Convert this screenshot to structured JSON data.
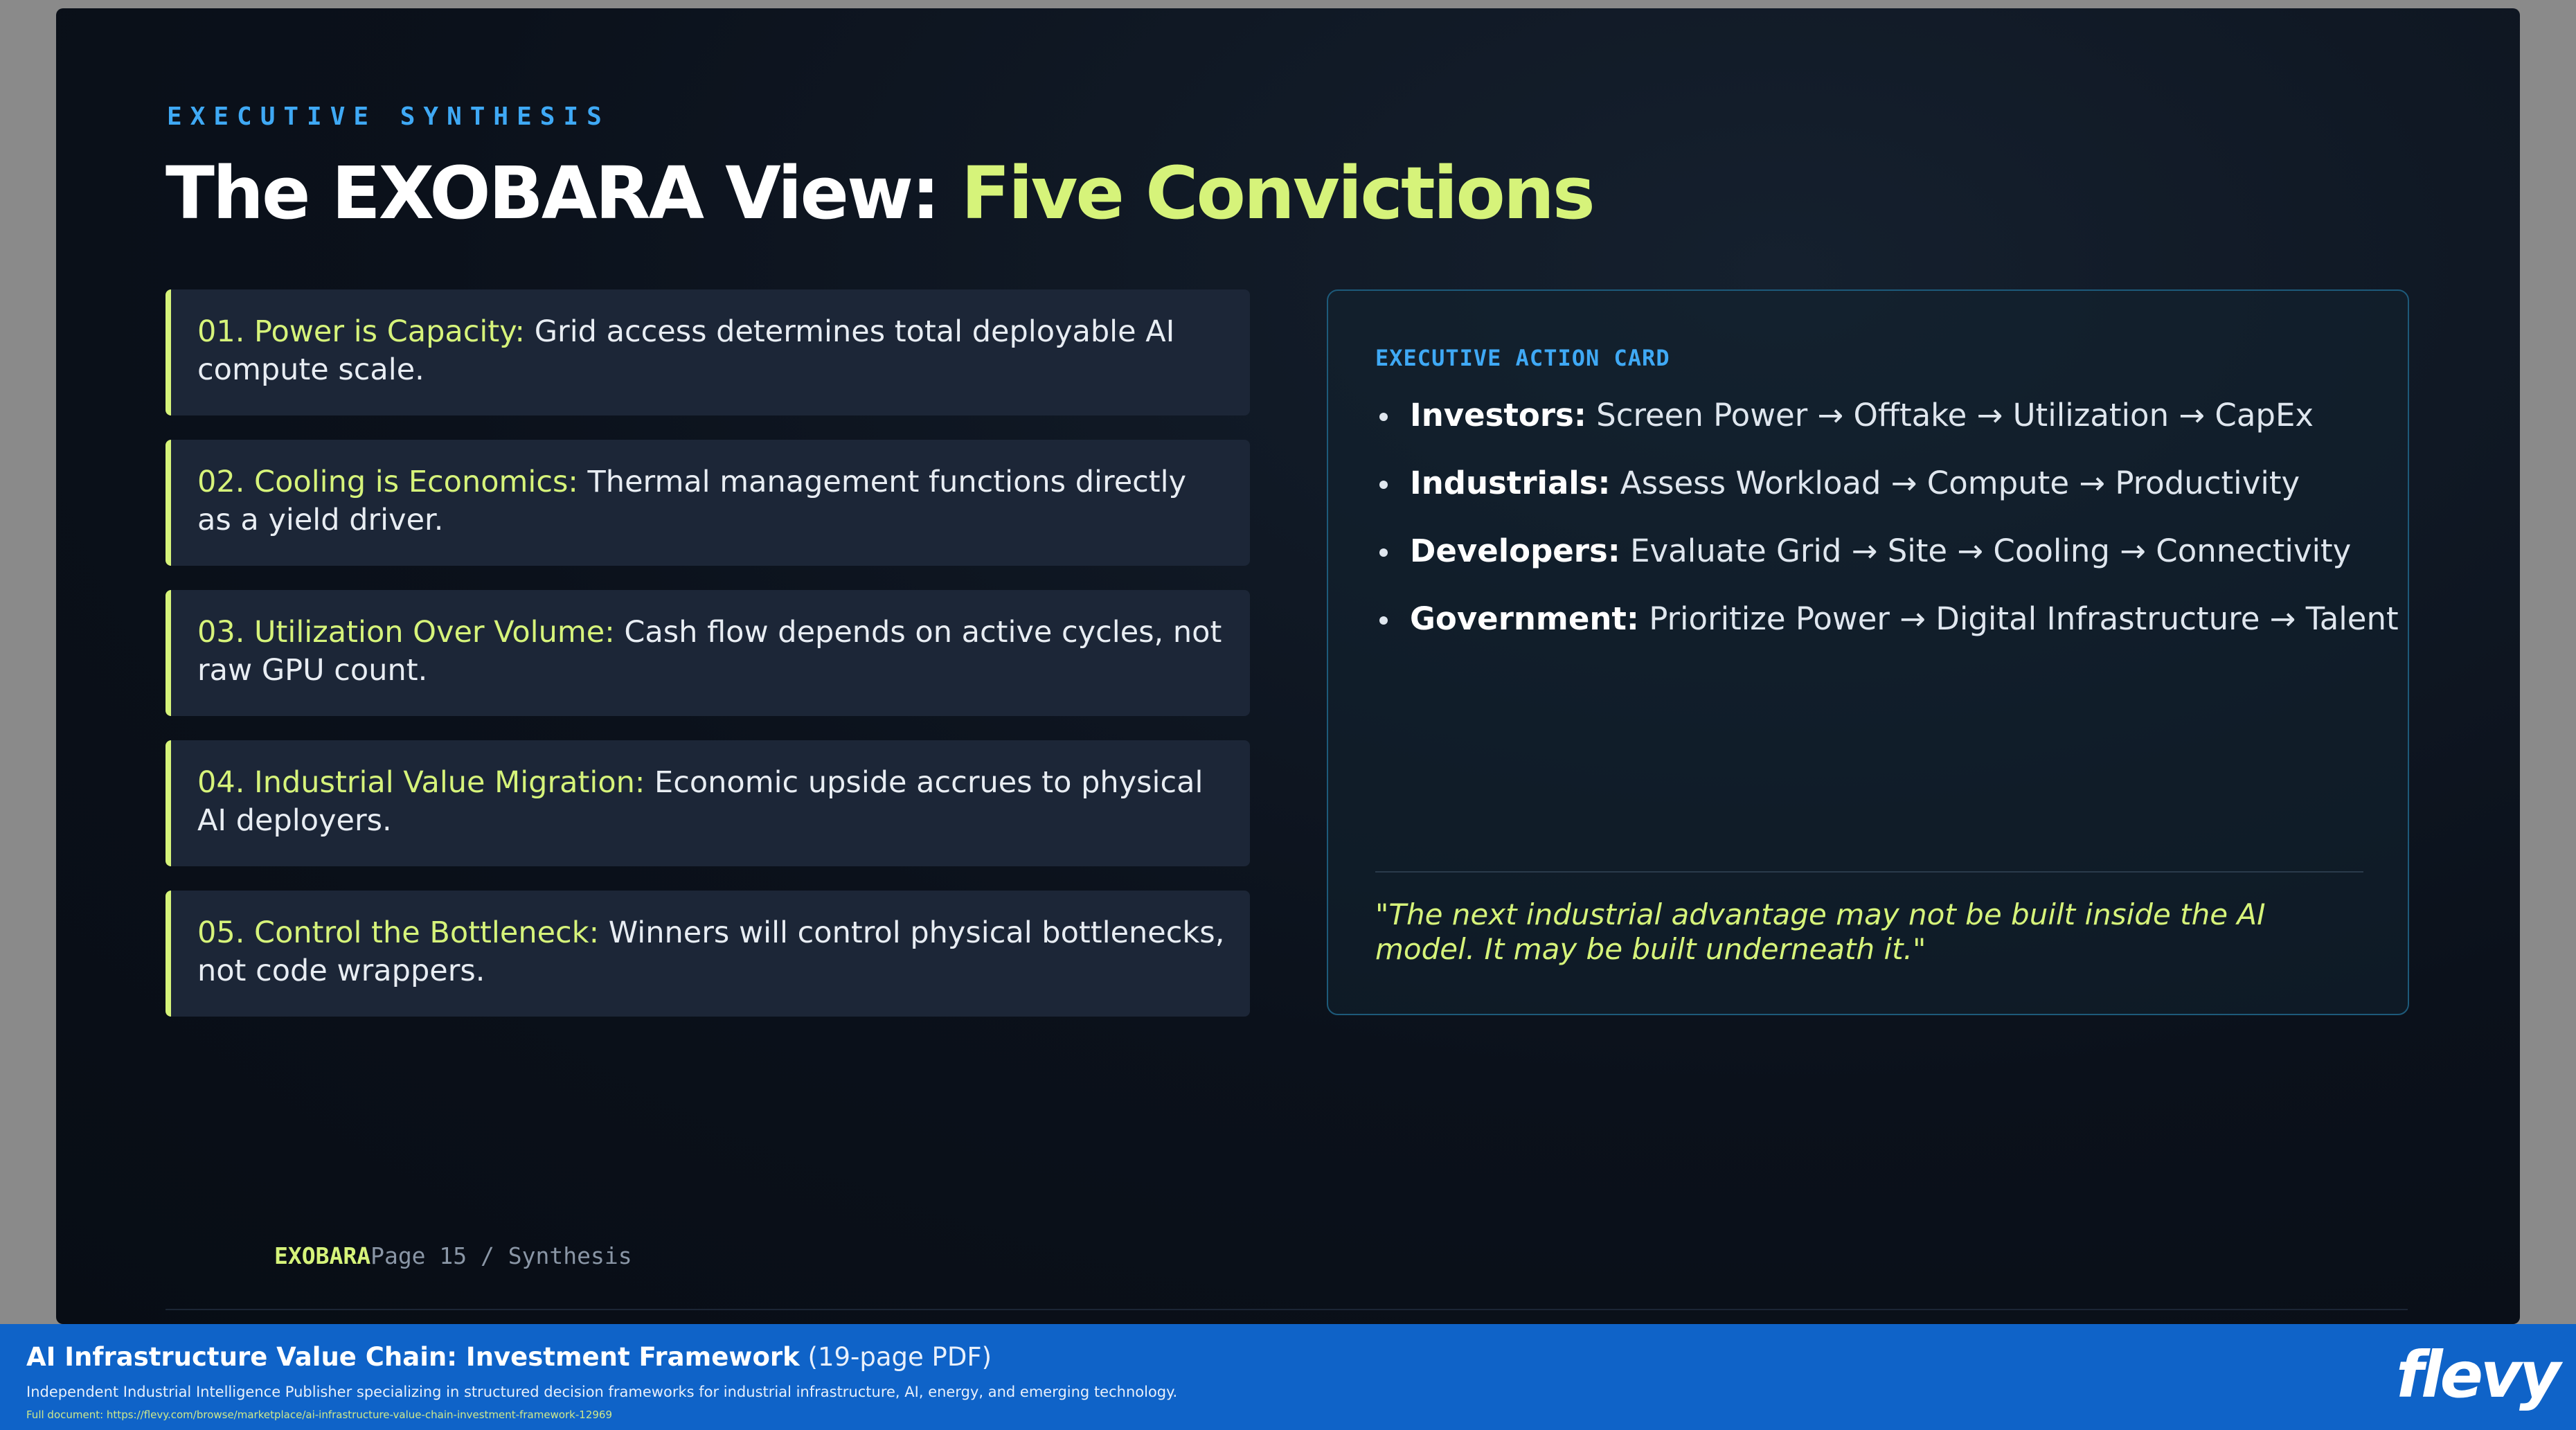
{
  "slide": {
    "eyebrow": "EXECUTIVE SYNTHESIS",
    "title_main": "The EXOBARA View: ",
    "title_accent": "Five Convictions",
    "convictions": [
      {
        "lead": "01. Power is Capacity:",
        "text": " Grid access determines total deployable AI compute scale."
      },
      {
        "lead": "02. Cooling is Economics:",
        "text": " Thermal management functions directly as a yield driver."
      },
      {
        "lead": "03. Utilization Over Volume:",
        "text": " Cash flow depends on active cycles, not raw GPU count."
      },
      {
        "lead": "04. Industrial Value Migration:",
        "text": " Economic upside accrues to physical AI deployers."
      },
      {
        "lead": "05. Control the Bottleneck:",
        "text": " Winners will control physical bottlenecks, not code wrappers."
      }
    ],
    "action_card": {
      "heading": "EXECUTIVE ACTION CARD",
      "items": [
        {
          "who": "Investors:",
          "path": " Screen Power → Offtake → Utilization → CapEx"
        },
        {
          "who": "Industrials:",
          "path": " Assess Workload → Compute → Productivity"
        },
        {
          "who": "Developers:",
          "path": " Evaluate Grid → Site → Cooling → Connectivity"
        },
        {
          "who": "Government:",
          "path": " Prioritize Power → Digital Infrastructure → Talent"
        }
      ],
      "quote": "\"The next industrial advantage may not be built inside the AI model. It may be built underneath it.\""
    },
    "footer": {
      "brand": "EXOBARA",
      "page": "Page 15 / Synthesis"
    }
  },
  "banner": {
    "title_bold": "AI Infrastructure Value Chain: Investment Framework",
    "title_suffix": " (19-page PDF)",
    "description": "Independent Industrial Intelligence Publisher specializing in structured decision frameworks for industrial infrastructure, AI, energy, and emerging technology.",
    "url": "Full document: https://flevy.com/browse/marketplace/ai-infrastructure-value-chain-investment-framework-12969",
    "logo": "flevy"
  },
  "colors": {
    "accent_lime": "#d6f37a",
    "accent_blue": "#3fa9f5",
    "banner_blue": "#0f63c8",
    "slide_bg": "#0b111b"
  }
}
